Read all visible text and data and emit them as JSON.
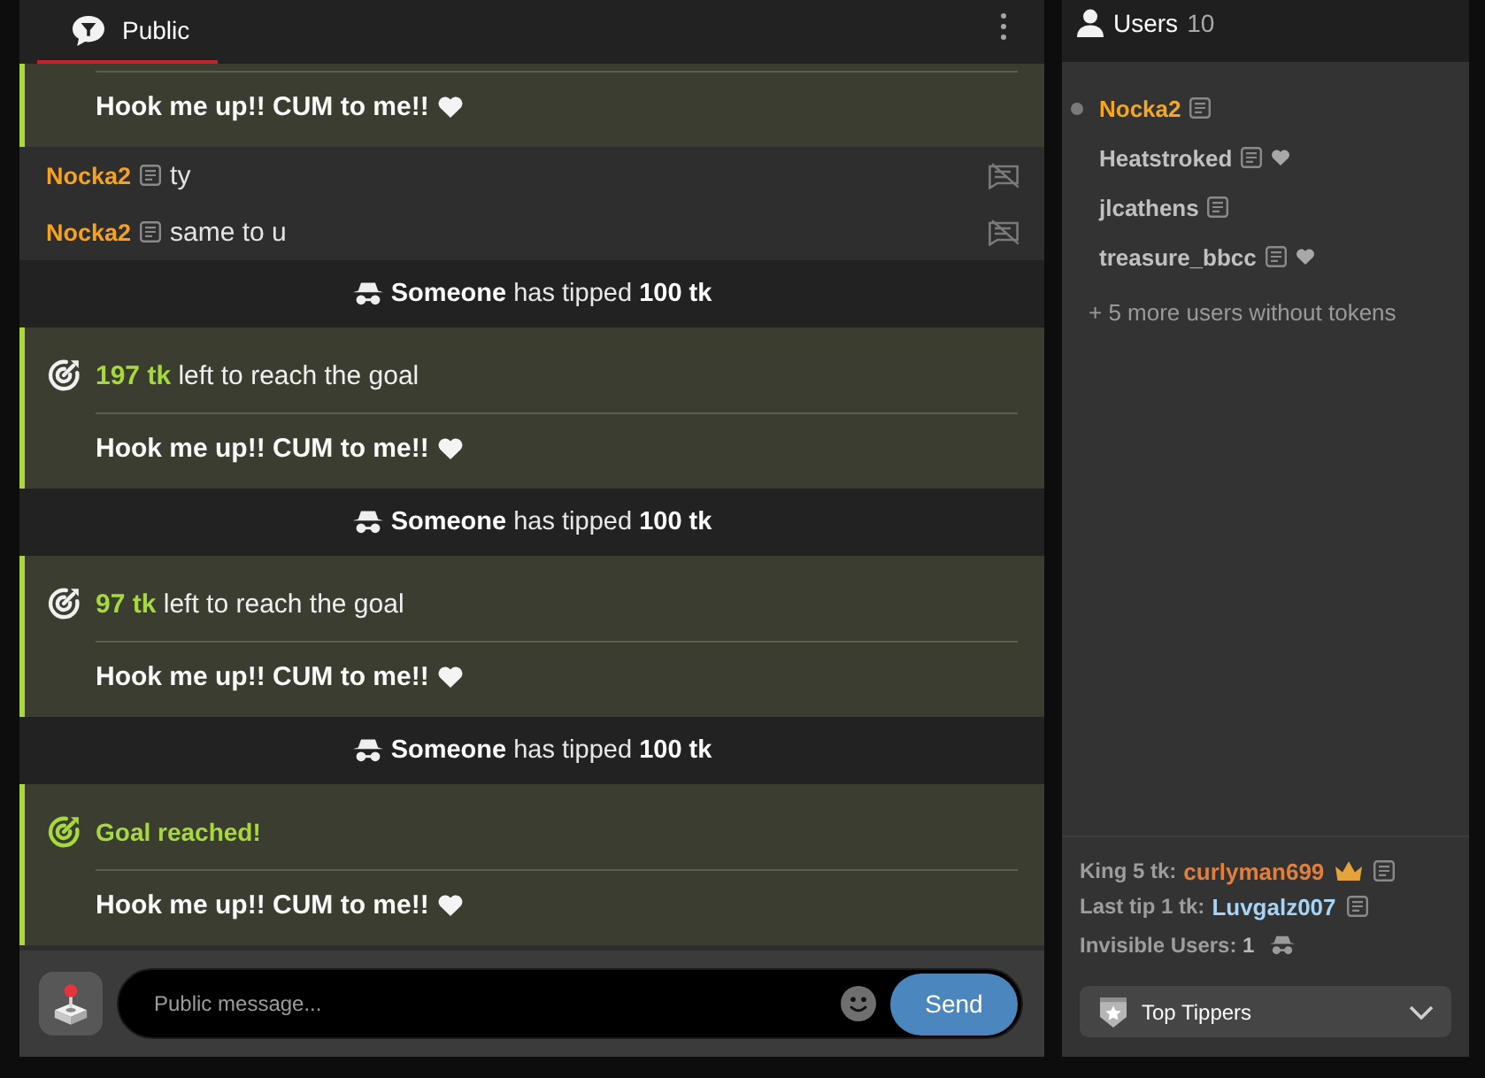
{
  "chat": {
    "tabs": [
      {
        "label": "Public",
        "selected": true
      }
    ],
    "messages": [
      {
        "kind": "goal",
        "message": "Hook me up!! CUM to me!!"
      },
      {
        "kind": "user",
        "name": "Nocka2",
        "text": "ty"
      },
      {
        "kind": "user",
        "name": "Nocka2",
        "text": "same to u"
      },
      {
        "kind": "tip",
        "text": "**Someone** has tipped **100 tk**"
      },
      {
        "kind": "goal",
        "reached": false,
        "headline": "**197 tk** left to reach the goal",
        "message": "Hook me up!! CUM to me!!"
      },
      {
        "kind": "tip",
        "text": "**Someone** has tipped **100 tk**"
      },
      {
        "kind": "goal",
        "reached": false,
        "headline": "**97 tk** left to reach the goal",
        "message": "Hook me up!! CUM to me!!"
      },
      {
        "kind": "tip",
        "text": "**Someone** has tipped **100 tk**"
      },
      {
        "kind": "goal",
        "reached": true,
        "headline": "Goal reached!",
        "message": "Hook me up!! CUM to me!!"
      }
    ],
    "composer": {
      "placeholder": "Public message...",
      "send": "Send"
    }
  },
  "users": {
    "title": "Users",
    "count": "10",
    "items": [
      {
        "name": "Nocka2",
        "color": "#f5a623",
        "selected": true,
        "heart": false
      },
      {
        "name": "Heatstroked",
        "color": "#c0c0c0",
        "selected": false,
        "heart": true
      },
      {
        "name": "jlcathens",
        "color": "#c0c0c0",
        "selected": false,
        "heart": false
      },
      {
        "name": "treasure_bbcc",
        "color": "#c0c0c0",
        "selected": false,
        "heart": true
      }
    ],
    "more": "+ 5 more users without tokens",
    "king": {
      "label": "King 5 tk:",
      "name": "curlyman699"
    },
    "last_tip": {
      "label": "Last tip 1 tk:",
      "name": "Luvgalz007"
    },
    "invisible": "Invisible Users: **1**",
    "top_tippers": {
      "label": "Top Tippers",
      "expanded": false
    }
  }
}
